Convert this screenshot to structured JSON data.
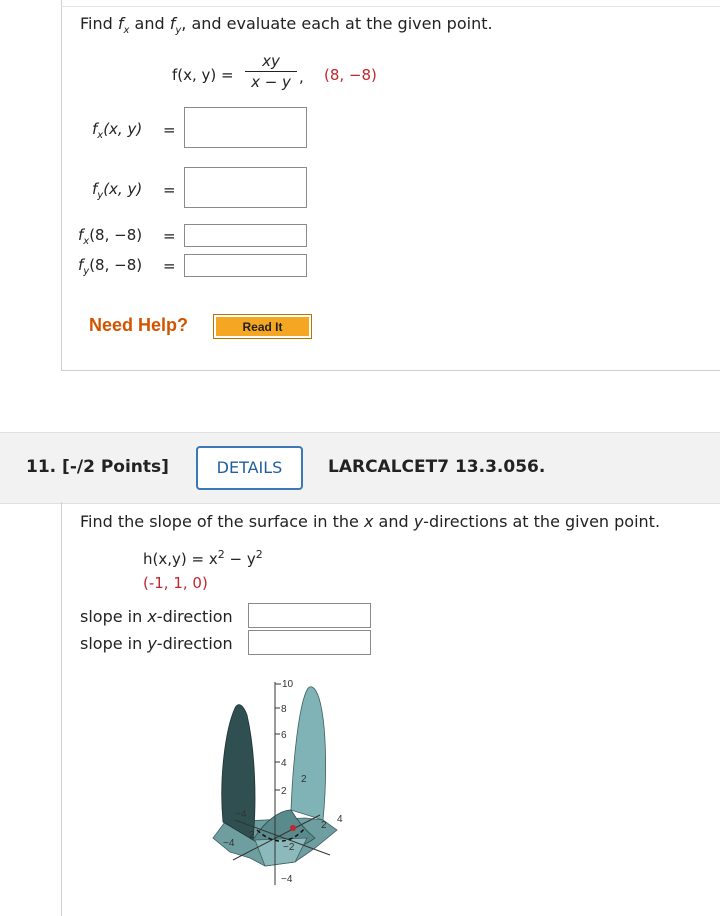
{
  "prev_question": {
    "instruction_parts": {
      "find": "Find ",
      "f1": "f",
      "s1": "x",
      "and1": " and ",
      "f2": "f",
      "s2": "y",
      "rest": ", and evaluate each at the given point."
    },
    "function_lhs": "f(x, y) = ",
    "numerator": "xy",
    "denominator": "x − y",
    "comma": ",",
    "point": "(8, −8)",
    "rows": [
      {
        "f": "f",
        "sub": "x",
        "arg": "(x, y)",
        "eq": "="
      },
      {
        "f": "f",
        "sub": "y",
        "arg": "(x, y)",
        "eq": "="
      },
      {
        "f": "f",
        "sub": "x",
        "arg": "(8, −8)",
        "eq": "="
      },
      {
        "f": "f",
        "sub": "y",
        "arg": "(8, −8)",
        "eq": "="
      }
    ],
    "need_help": "Need Help?",
    "read_it": "Read It"
  },
  "question": {
    "number": "11.",
    "points": "[-/2 Points]",
    "details_label": "DETAILS",
    "code": "LARCALCET7 13.3.056.",
    "instruction_a": "Find the slope of the surface in the ",
    "var_x": "x",
    "instruction_b": " and ",
    "var_y": "y",
    "instruction_c": "-directions at the given point.",
    "func_lhs": "h(x,y) = x",
    "sq1": "2",
    "minus": " − y",
    "sq2": "2",
    "point": "(-1, 1, 0)",
    "slope_x_a": "slope in ",
    "slope_x_var": "x",
    "slope_x_b": "-direction",
    "slope_y_a": "slope in ",
    "slope_y_var": "y",
    "slope_y_b": "-direction"
  },
  "graph": {
    "z_ticks": [
      "10",
      "8",
      "6",
      "4",
      "2"
    ],
    "z_neg": "−4",
    "labels": [
      "−4",
      "2",
      "−4",
      "2",
      "4",
      "2",
      "−2",
      "4",
      "−2"
    ]
  }
}
